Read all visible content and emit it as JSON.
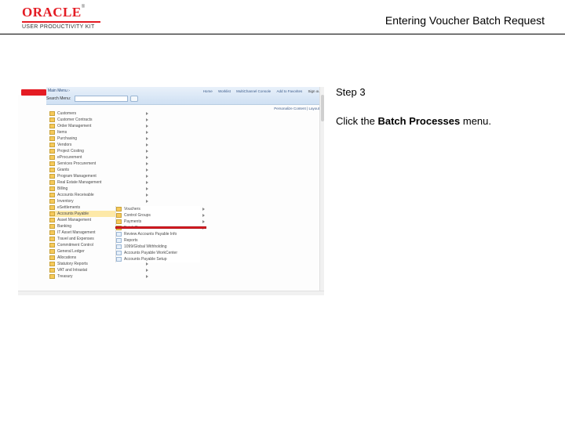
{
  "header": {
    "brand": "ORACLE",
    "product": "USER PRODUCTIVITY KIT",
    "title": "Entering Voucher Batch Request"
  },
  "instruction": {
    "step_label": "Step 3",
    "line_prefix": "Click the ",
    "line_bold": "Batch Processes",
    "line_suffix": " menu."
  },
  "app": {
    "menu_label": "Main Menu",
    "search_label": "Search Menu:",
    "nav": {
      "home": "Home",
      "worklist": "Worklist",
      "mcc": "MultiChannel Console",
      "fav": "Add to Favorites",
      "signout": "Sign out"
    },
    "personalize": "Personalize Content | Layout",
    "tree": [
      "Customers",
      "Customer Contracts",
      "Order Management",
      "Items",
      "Purchasing",
      "Vendors",
      "Project Costing",
      "eProcurement",
      "Services Procurement",
      "Grants",
      "Program Management",
      "Real Estate Management",
      "Billing",
      "Accounts Receivable",
      "Inventory",
      "eSettlements",
      "Accounts Payable",
      "Asset Management",
      "Banking",
      "IT Asset Management",
      "Travel and Expenses",
      "Commitment Control",
      "General Ledger",
      "Allocations",
      "Statutory Reports",
      "VAT and Intrastat",
      "Treasury"
    ],
    "selected_index": 16,
    "submenu": [
      "Vouchers",
      "Control Groups",
      "Payments",
      "Batch Processes",
      "Review Accounts Payable Info",
      "Reports",
      "1099/Global Withholding",
      "Accounts Payable WorkCenter",
      "Accounts Payable Setup"
    ],
    "highlight_index": 3
  }
}
